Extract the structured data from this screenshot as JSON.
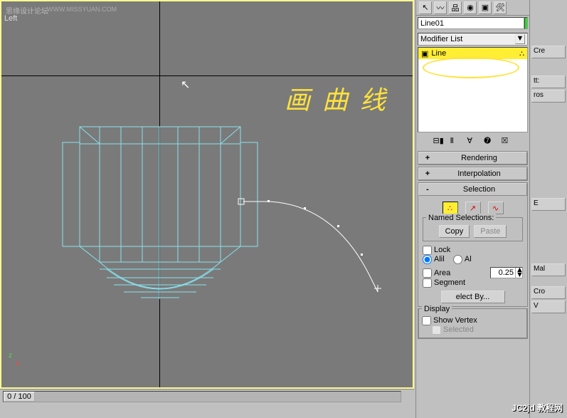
{
  "viewport": {
    "label": "Left"
  },
  "watermark_cn": "思缘设计论坛",
  "watermark_url": "WWW.MISSYUAN.COM",
  "annotation": "画 曲 线",
  "axes": {
    "z": "z",
    "x": "x"
  },
  "timeline": {
    "range": "0 / 100",
    "frame": "0"
  },
  "tabs": {
    "t1": "↖",
    "t2": "〰",
    "t3": "品",
    "t4": "◉",
    "t5": "▣",
    "t6": "🛠"
  },
  "object_name": "Line01",
  "modifier_list_label": "Modifier List",
  "stack": {
    "expand": "▣",
    "item": "Line",
    "dots": "∴"
  },
  "stacktools": {
    "a": "⊟▮",
    "b": "Ⅱ",
    "c": "∀",
    "d": "➐",
    "e": "☒"
  },
  "rollouts": {
    "rendering": {
      "pm": "+",
      "title": "Rendering"
    },
    "interpolation": {
      "pm": "+",
      "title": "Interpolation"
    },
    "selection": {
      "pm": "-",
      "title": "Selection",
      "sub_vertex": "∴",
      "sub_segment": "↗",
      "sub_spline": "∿",
      "named_label": "Named Selections:",
      "copy": "Copy",
      "paste": "Paste",
      "lock": "Lock",
      "radio_all": "Alil",
      "radio_al": "Al",
      "area": "Area",
      "area_val": "0.25",
      "segment": "Segment",
      "selectby": "elect By..."
    },
    "display": {
      "title": "Display",
      "show_vertex": "Show Vertex",
      "selected": "Selected"
    }
  },
  "extra_panel": {
    "cre": "Cre",
    "tts": "tt:",
    "ros": "ros",
    "e": "E",
    "mal": "Mal",
    "cro": "Cro",
    "v": "V"
  },
  "bottom_wm": "JC2jd 教程网"
}
